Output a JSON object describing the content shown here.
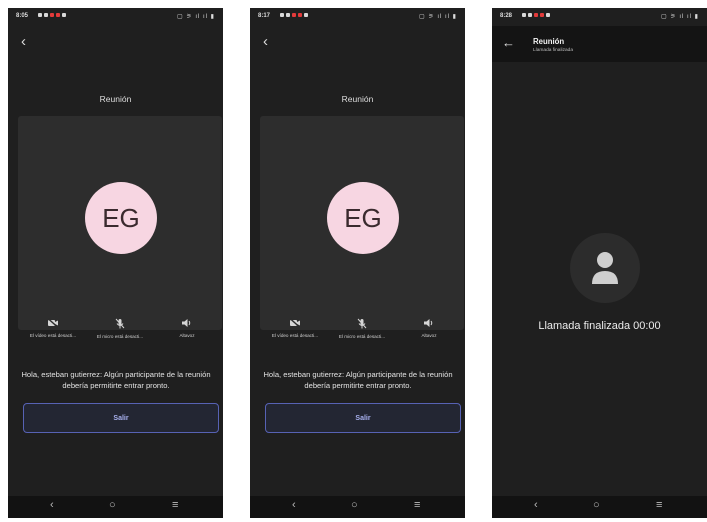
{
  "phone1": {
    "status_time": "8:05",
    "status_right": "▢ ⚞ ıl ıl ▮",
    "back_glyph": "‹",
    "title": "Reunión",
    "avatar_initials": "EG",
    "controls": {
      "video_label": "El vídeo está desacti...",
      "mic_label": "El micro está desacti...",
      "speaker_label": "Altavoz"
    },
    "message": "Hola, esteban gutierrez: Algún participante de la reunión debería permitirte entrar pronto.",
    "leave_button": "Salir",
    "nav": {
      "back": "‹",
      "home": "○",
      "menu": "≡"
    }
  },
  "phone2": {
    "status_time": "8:17",
    "status_right": "▢ ⚞ ıl ıl ▮",
    "back_glyph": "‹",
    "title": "Reunión",
    "avatar_initials": "EG",
    "controls": {
      "video_label": "El vídeo está desacti...",
      "mic_label": "El micro está desacti...",
      "speaker_label": "Altavoz"
    },
    "message": "Hola, esteban gutierrez: Algún participante de la reunión debería permitirte entrar pronto.",
    "leave_button": "Salir",
    "nav": {
      "back": "‹",
      "home": "○",
      "menu": "≡"
    }
  },
  "phone3": {
    "status_time": "8:28",
    "status_right": "▢ ⚞ ıl ıl ▮",
    "back_glyph": "←",
    "title": "Reunión",
    "subtitle": "Llamada finalizada",
    "status_text": "Llamada finalizada 00:00",
    "nav": {
      "back": "‹",
      "home": "○",
      "menu": "≡"
    }
  },
  "colors": {
    "background": "#1f1f1f",
    "card": "#2d2d2d",
    "avatar_bg": "#f7d6e2",
    "button_border": "#5762b4",
    "button_text": "#a9b2f0"
  }
}
